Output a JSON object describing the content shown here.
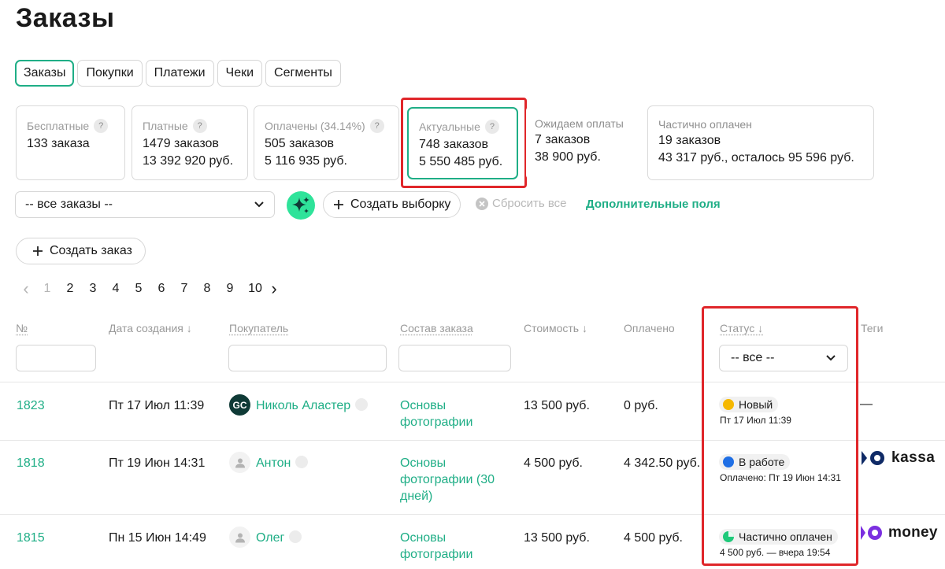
{
  "page_title": "Заказы",
  "tabs": [
    {
      "label": "Заказы",
      "active": true
    },
    {
      "label": "Покупки"
    },
    {
      "label": "Платежи"
    },
    {
      "label": "Чеки"
    },
    {
      "label": "Сегменты"
    }
  ],
  "cards": [
    {
      "label": "Бесплатные",
      "line1": "133 заказа",
      "line2": ""
    },
    {
      "label": "Платные",
      "line1": "1479 заказов",
      "line2": "13 392 920 руб."
    },
    {
      "label": "Оплачены (34.14%)",
      "line1": "505 заказов",
      "line2": "5 116 935 руб."
    },
    {
      "label": "Актуальные",
      "line1": "748 заказов",
      "line2": "5 550 485 руб."
    },
    {
      "label": "Ожидаем оплаты",
      "line1": "7 заказов",
      "line2": "38 900 руб."
    },
    {
      "label": "Частично оплачен",
      "line1": "19 заказов",
      "line2": "43 317 руб., осталось 95 596 руб."
    }
  ],
  "help_mark": "?",
  "filters": {
    "orders_select": "-- все заказы --",
    "create_selection": "Создать выборку",
    "reset_all": "Сбросить все",
    "extra_fields": "Дополнительные поля"
  },
  "create_order": "Создать заказ",
  "pagination": {
    "prev": "‹",
    "pages": [
      "1",
      "2",
      "3",
      "4",
      "5",
      "6",
      "7",
      "8",
      "9",
      "10"
    ],
    "current": "1",
    "next": "›"
  },
  "table": {
    "headers": {
      "num": "№",
      "created": "Дата создания ↓",
      "buyer": "Покупатель",
      "contents": "Состав заказа",
      "cost": "Стоимость ↓",
      "paid": "Оплачено",
      "status": "Статус ↓",
      "tags": "Теги"
    },
    "status_filter": "-- все --",
    "rows": [
      {
        "num": "1823",
        "created": "Пт 17 Июл 11:39",
        "buyer": "Николь Аластер",
        "avatar": "GC",
        "contents_1": "Основы",
        "contents_2": "фотографии",
        "contents_3": "",
        "cost": "13 500 руб.",
        "paid": "0 руб.",
        "status": "Новый",
        "status_color": "#f5b800",
        "status_sub": "Пт 17 Июл 11:39",
        "tag": "—"
      },
      {
        "num": "1818",
        "created": "Пт 19 Июн 14:31",
        "buyer": "Антон",
        "contents_1": "Основы",
        "contents_2": "фотографии (30",
        "contents_3": "дней)",
        "cost": "4 500 руб.",
        "paid": "4 342.50 руб.",
        "status": "В работе",
        "status_color": "#1f6fe5",
        "status_sub": "Оплачено: Пт 19 Июн 14:31",
        "tag": "kassa"
      },
      {
        "num": "1815",
        "created": "Пн 15 Июн 14:49",
        "buyer": "Олег",
        "contents_1": "Основы",
        "contents_2": "фотографии",
        "contents_3": "",
        "cost": "13 500 руб.",
        "paid": "4 500 руб.",
        "status": "Частично оплачен",
        "status_color": "#1fc97a",
        "status_sub": "4 500 руб. — вчера 19:54",
        "tag": "money"
      }
    ]
  },
  "colors": {
    "accent": "#1fae86",
    "highlight_border": "#e0262a"
  }
}
